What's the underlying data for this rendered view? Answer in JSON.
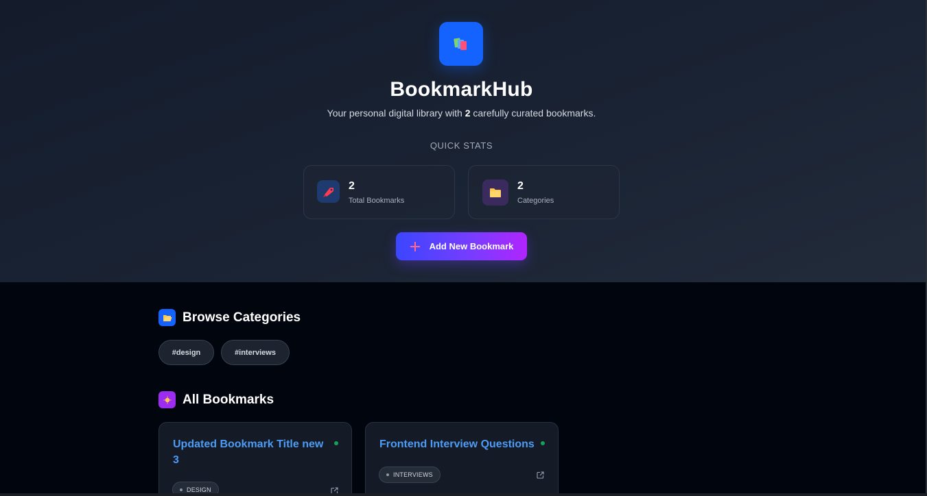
{
  "app": {
    "title": "BookmarkHub",
    "subtitle_prefix": "Your personal digital library with ",
    "subtitle_count": "2",
    "subtitle_suffix": " carefully curated bookmarks.",
    "logo_icon": "books-icon",
    "brand_color": "#1463ff"
  },
  "quick_stats": {
    "label": "QUICK STATS",
    "cards": [
      {
        "value": "2",
        "label": "Total Bookmarks",
        "icon": "bookmark-tag-icon"
      },
      {
        "value": "2",
        "label": "Categories",
        "icon": "folder-icon"
      }
    ]
  },
  "add_button": {
    "label": "Add New Bookmark",
    "icon": "plus-icon"
  },
  "categories": {
    "title": "Browse Categories",
    "icon": "open-folder-icon",
    "chips": [
      "#design",
      "#interviews"
    ]
  },
  "bookmarks": {
    "title": "All Bookmarks",
    "icon": "sparkle-icon",
    "items": [
      {
        "title": "Updated Bookmark Title new 3",
        "tag": "DESIGN",
        "status_color": "#14a15a"
      },
      {
        "title": "Frontend Interview Questions",
        "tag": "INTERVIEWS",
        "status_color": "#14a15a"
      }
    ]
  }
}
